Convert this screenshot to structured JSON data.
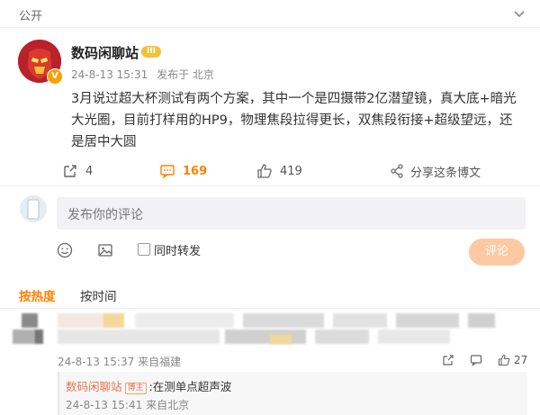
{
  "header": {
    "visibility_label": "公开"
  },
  "post": {
    "author": "数码闲聊站",
    "level_badge": "III",
    "verified_badge": "V",
    "timestamp": "24-8-13 15:31",
    "source": "发布于 北京",
    "content": "3月说过超大杯测试有两个方案，其中一个是四摄带2亿潜望镜，真大底+暗光大光圈，目前打样用的HP9，物理焦段拉得更长，双焦段衔接+超级望远，还是居中大圆"
  },
  "actions": {
    "forward_count": "4",
    "comment_count": "169",
    "like_count": "419",
    "share_label": "分享这条博文"
  },
  "composer": {
    "placeholder": "发布你的评论",
    "sync_label": "同时转发",
    "submit_label": "评论"
  },
  "sort_tabs": {
    "hot": "按热度",
    "time": "按时间"
  },
  "comment": {
    "timestamp": "24-8-13 15:37",
    "source": "来自福建",
    "like_count": "27",
    "reply": {
      "author": "数码闲聊站",
      "role_tag": "博主",
      "text": ":在测单点超声波",
      "timestamp": "24-8-13 15:41",
      "source": "来自北京"
    }
  },
  "colors": {
    "accent": "#ff8200",
    "reply_name": "#eb7350",
    "button_disabled": "#fcc9a3"
  }
}
